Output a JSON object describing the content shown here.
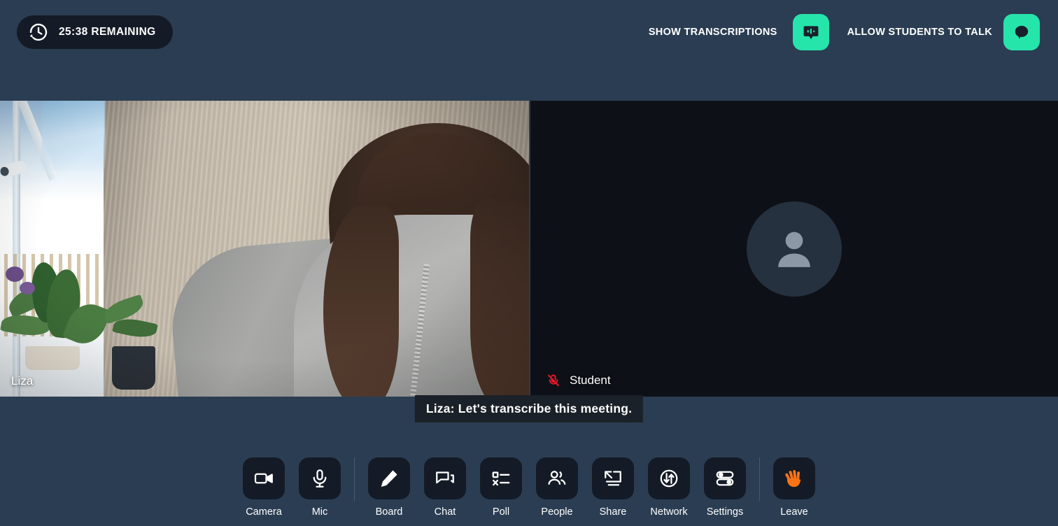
{
  "theme": {
    "page_background": "#2b3d52",
    "panel_background": "#141b26",
    "peer_tile_background": "#0d1117",
    "accent_green": "#26e5ab",
    "accent_orange": "#f97316",
    "muted_red": "#e8192c",
    "text_primary": "#ffffff"
  },
  "topbar": {
    "timer": {
      "icon": "clock-rewind-icon",
      "text": "25:38 REMAINING"
    },
    "transcriptions": {
      "label": "SHOW TRANSCRIPTIONS",
      "icon": "transcription-bubble-icon",
      "state": "on"
    },
    "allow_talk": {
      "label": "ALLOW STUDENTS TO TALK",
      "icon": "speech-bubble-icon",
      "state": "on"
    }
  },
  "stage": {
    "tiles": [
      {
        "name": "Liza",
        "kind": "video",
        "muted": false,
        "mic_icon": ""
      },
      {
        "name": "Student",
        "kind": "avatar",
        "muted": true,
        "mic_icon": "mic-muted-icon",
        "avatar_icon": "person-avatar-icon"
      }
    ]
  },
  "caption": {
    "text": "Liza: Let's transcribe this meeting."
  },
  "toolbar": {
    "items": [
      {
        "label": "Camera",
        "icon": "camera-icon",
        "group": 1
      },
      {
        "label": "Mic",
        "icon": "mic-icon",
        "group": 1
      },
      {
        "label": "Board",
        "icon": "pencil-icon",
        "group": 2
      },
      {
        "label": "Chat",
        "icon": "chat-icon",
        "group": 2
      },
      {
        "label": "Poll",
        "icon": "poll-icon",
        "group": 2
      },
      {
        "label": "People",
        "icon": "people-icon",
        "group": 2
      },
      {
        "label": "Share",
        "icon": "screen-share-icon",
        "group": 2
      },
      {
        "label": "Network",
        "icon": "network-icon",
        "group": 2
      },
      {
        "label": "Settings",
        "icon": "settings-toggles-icon",
        "group": 2
      },
      {
        "label": "Leave",
        "icon": "waving-hand-icon",
        "group": 3
      }
    ]
  }
}
